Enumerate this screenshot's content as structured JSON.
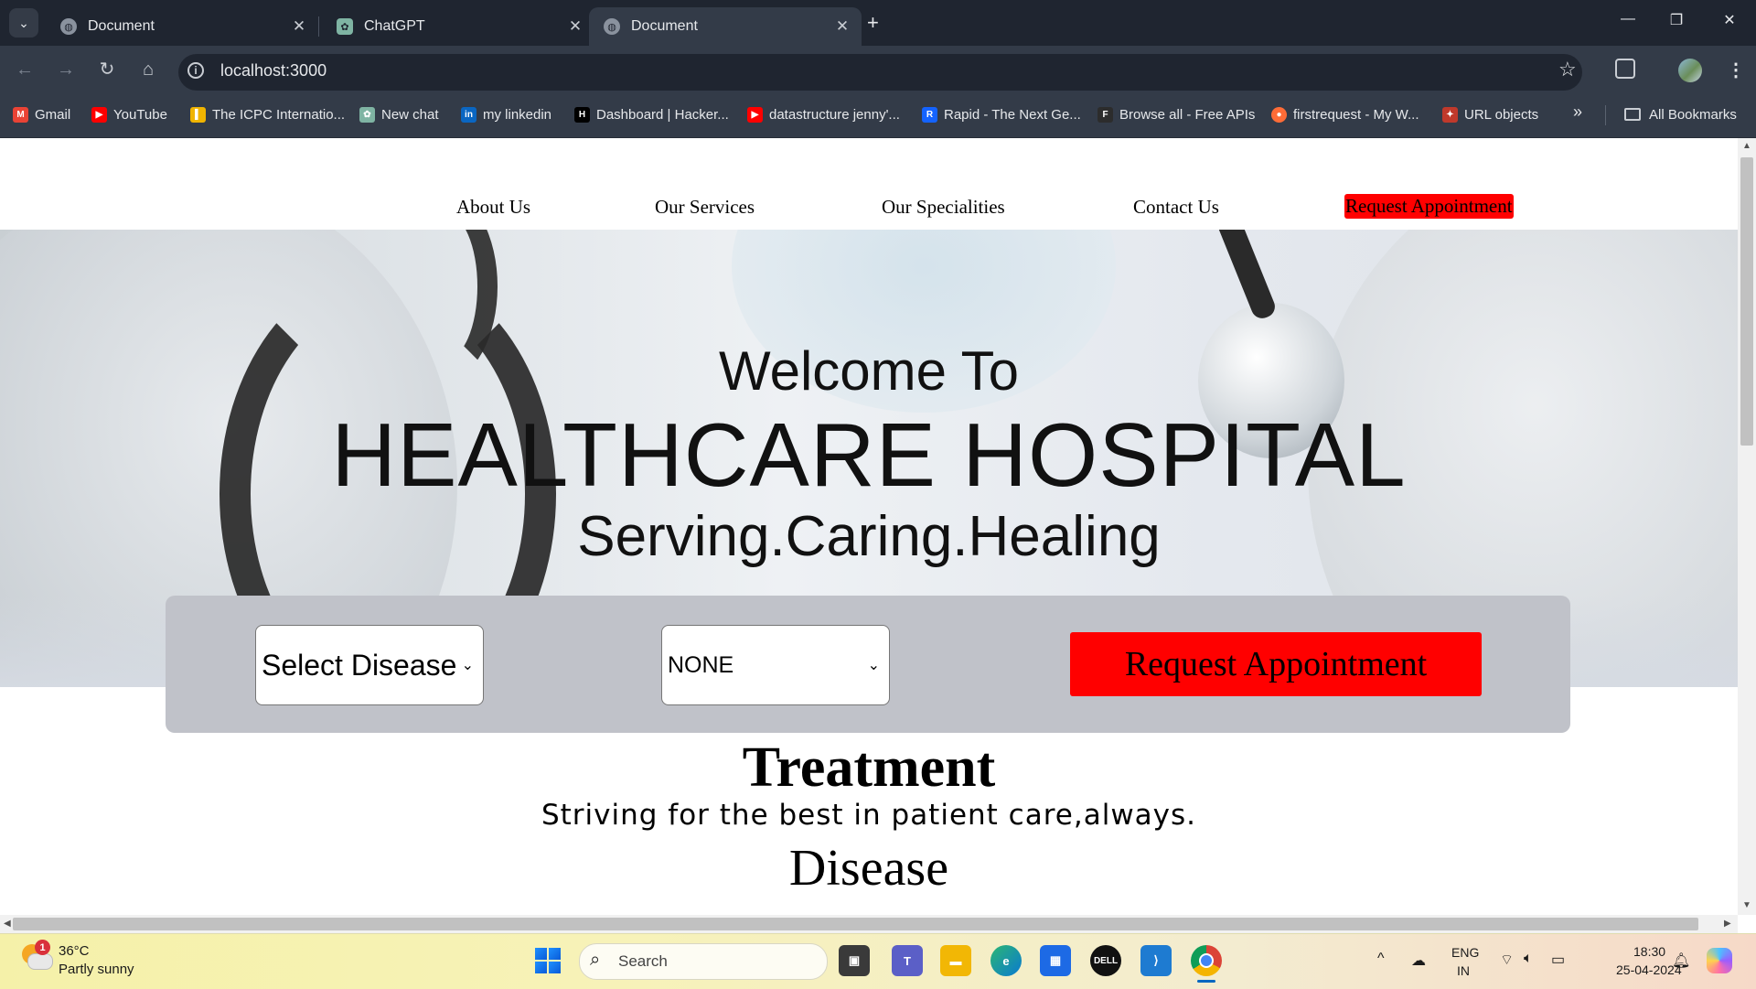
{
  "browser": {
    "tabs": [
      {
        "title": "Document",
        "active": false
      },
      {
        "title": "ChatGPT",
        "active": false
      },
      {
        "title": "Document",
        "active": true
      }
    ],
    "address": "localhost:3000",
    "bookmarks": [
      "Gmail",
      "YouTube",
      "The ICPC Internatio...",
      "New chat",
      "my linkedin",
      "Dashboard | Hacker...",
      "datastructure jenny'...",
      "Rapid - The Next Ge...",
      "Browse all - Free APIs",
      "firstrequest - My W...",
      "URL objects"
    ],
    "all_bookmarks": "All Bookmarks"
  },
  "nav": {
    "items": [
      "About Us",
      "Our Services",
      "Our Specialities",
      "Contact Us"
    ],
    "cta": "Request Appointment"
  },
  "hero": {
    "welcome": "Welcome To",
    "title": "HEALTHCARE HOSPITAL",
    "tagline": "Serving.Caring.Healing"
  },
  "booking": {
    "disease_select": "Select Disease",
    "second_select": "NONE",
    "button": "Request Appointment"
  },
  "sections": {
    "treatment_title": "Treatment",
    "treatment_sub": "Striving for the best in patient care,always.",
    "disease_title": "Disease"
  },
  "taskbar": {
    "weather_temp": "36°C",
    "weather_desc": "Partly sunny",
    "weather_badge": "1",
    "search_placeholder": "Search",
    "lang_top": "ENG",
    "lang_bottom": "IN",
    "time": "18:30",
    "date": "25-04-2024"
  },
  "colors": {
    "accent_red": "#ff0000",
    "panel_gray": "#c0c2c9",
    "chrome_dark": "#1f2530"
  }
}
